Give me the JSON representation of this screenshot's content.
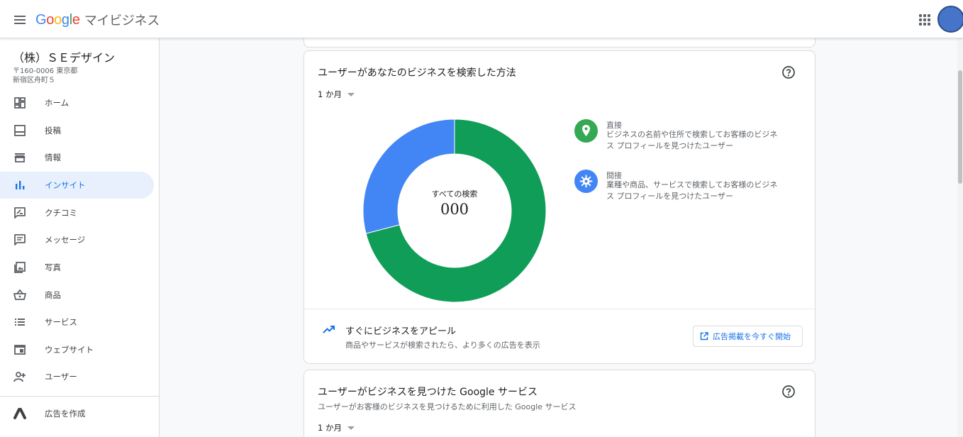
{
  "header": {
    "logo_letters": [
      "G",
      "o",
      "o",
      "g",
      "l",
      "e"
    ],
    "logo_colors": [
      "#4285f4",
      "#ea4335",
      "#fbbc05",
      "#4285f4",
      "#34a853",
      "#ea4335"
    ],
    "product": "マイビジネス"
  },
  "sidebar": {
    "business_name": "（株）ＳＥデザイン",
    "address": "〒160-0006 東京都\n新宿区舟町５",
    "items": [
      {
        "label": "ホーム",
        "icon": "dashboard-icon"
      },
      {
        "label": "投稿",
        "icon": "post-icon"
      },
      {
        "label": "情報",
        "icon": "storefront-icon"
      },
      {
        "label": "インサイト",
        "icon": "bar-chart-icon",
        "active": true
      },
      {
        "label": "クチコミ",
        "icon": "review-icon"
      },
      {
        "label": "メッセージ",
        "icon": "message-icon"
      },
      {
        "label": "写真",
        "icon": "photo-icon"
      },
      {
        "label": "商品",
        "icon": "basket-icon"
      },
      {
        "label": "サービス",
        "icon": "list-icon"
      },
      {
        "label": "ウェブサイト",
        "icon": "website-icon"
      },
      {
        "label": "ユーザー",
        "icon": "add-user-icon"
      }
    ],
    "ads_item": {
      "label": "広告を作成",
      "icon": "google-ads-icon"
    }
  },
  "search_card": {
    "title": "ユーザーがあなたのビジネスを検索した方法",
    "period": "1 か月",
    "center_label": "すべての検索",
    "center_value": "000",
    "legend": [
      {
        "title": "直接",
        "desc": "ビジネスの名前や住所で検索してお客様のビジネス プロフィールを見つけたユーザー",
        "color": "#34a853",
        "icon": "location-pin-icon"
      },
      {
        "title": "間接",
        "desc": "業種や商品、サービスで検索してお客様のビジネス プロフィールを見つけたユーザー",
        "color": "#4285f4",
        "icon": "discovery-icon"
      }
    ],
    "appeal_title": "すぐにビジネスをアピール",
    "appeal_desc": "商品やサービスが検索されたら、より多くの広告を表示",
    "ad_button_label": "広告掲載を今すぐ開始"
  },
  "chart_data": {
    "type": "pie",
    "categories": [
      "直接",
      "間接"
    ],
    "values": [
      71,
      29
    ],
    "colors": [
      "#0f9d58",
      "#4285f4"
    ],
    "title": "",
    "center_label": "すべての検索",
    "center_value": "000"
  },
  "google_card": {
    "title": "ユーザーがビジネスを見つけた Google サービス",
    "subtitle": "ユーザーがお客様のビジネスを見つけるために利用した Google サービス",
    "period": "1 か月"
  }
}
